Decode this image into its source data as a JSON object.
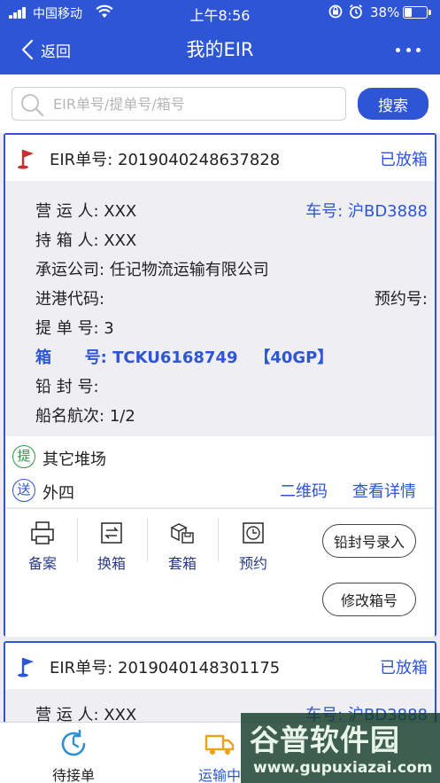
{
  "status_bar": {
    "carrier": "中国移动",
    "time": "上午8:56",
    "battery": "38%",
    "battery_level": 0.38
  },
  "nav": {
    "back_label": "返回",
    "title": "我的EIR"
  },
  "search": {
    "placeholder": "EIR单号/提单号/箱号",
    "value": "",
    "button_label": "搜索"
  },
  "colors": {
    "primary": "#2d55d6",
    "flag_red": "#c9302c",
    "badge_green": "#2f9a3a"
  },
  "cards": [
    {
      "eir_label": "EIR单号:",
      "eir_number": "2019040248637828",
      "status": "已放箱",
      "operator_label": "营 运 人:",
      "operator": "XXX",
      "truck_label": "车号:",
      "truck": "沪BD3888",
      "holder_label": "持 箱 人:",
      "holder": "XXX",
      "carrier_label": "承运公司:",
      "carrier": "任记物流运输有限公司",
      "port_code_label": "进港代码:",
      "port_code": "",
      "appointment_label": "预约号:",
      "appointment": "",
      "bill_label": "提 单 号:",
      "bill": "3",
      "box_label": "箱      号:",
      "box": "TCKU6168749",
      "box_type": "【40GP】",
      "seal_label": "铅 封 号:",
      "seal": "",
      "voyage_label": "船名航次:",
      "voyage": "1/2",
      "pickup_badge": "提",
      "pickup": "其它堆场",
      "deliver_badge": "送",
      "deliver": "外四",
      "qr_link": "二维码",
      "detail_link": "查看详情",
      "actions": [
        "备案",
        "换箱",
        "套箱",
        "预约"
      ],
      "seal_entry_button": "铅封号录入",
      "modify_box_button": "修改箱号"
    },
    {
      "eir_label": "EIR单号:",
      "eir_number": "2019040148301175",
      "status": "已放箱",
      "operator_label": "营 运 人:",
      "operator": "XXX",
      "truck_label": "车号:",
      "truck": "沪BD3888"
    }
  ],
  "tabbar": {
    "tabs": [
      {
        "label": "待接单",
        "icon": "refresh-clock-icon",
        "active": false
      },
      {
        "label": "运输中",
        "icon": "truck-icon",
        "active": true
      }
    ]
  },
  "watermark": {
    "logo_text": "谷普软件园",
    "url": "www.gupuxiazai.com"
  }
}
